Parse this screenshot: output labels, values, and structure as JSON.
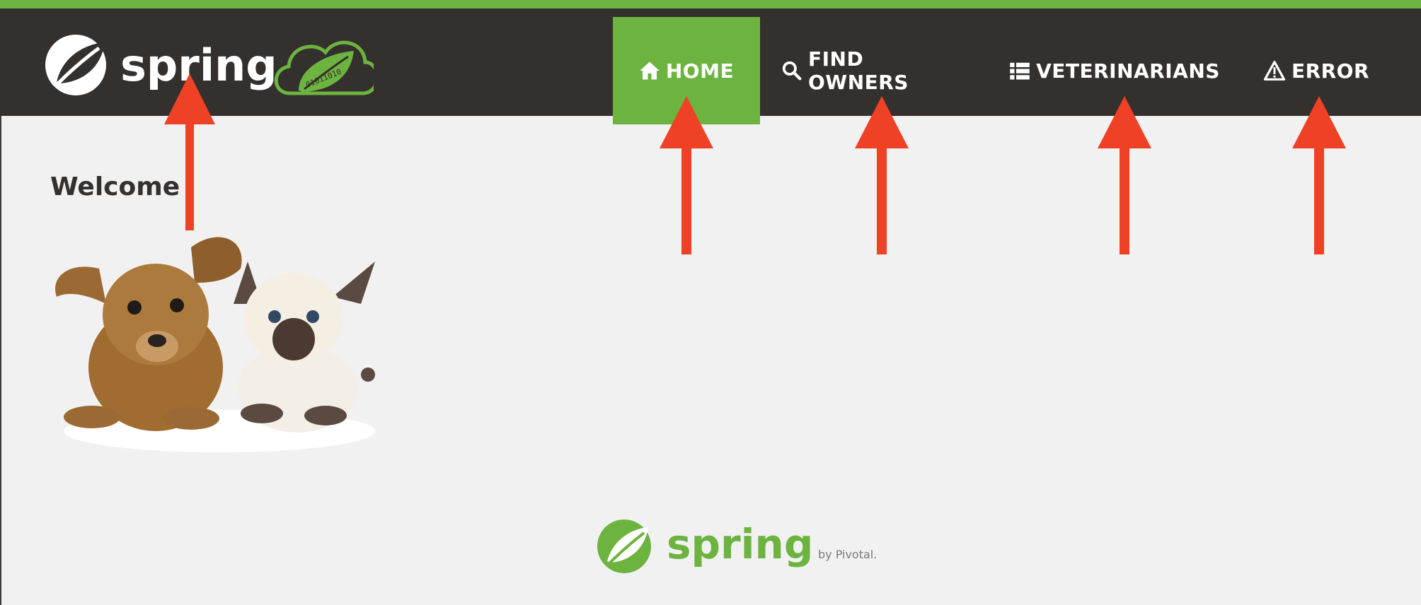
{
  "header": {
    "logo": {
      "wordmark": "spring",
      "badge_text": "01011010"
    },
    "nav": [
      {
        "label": "HOME",
        "icon": "home-icon",
        "active": true
      },
      {
        "label": "FIND OWNERS",
        "icon": "search-icon",
        "active": false
      },
      {
        "label": "VETERINARIANS",
        "icon": "list-icon",
        "active": false
      },
      {
        "label": "ERROR",
        "icon": "warning-icon",
        "active": false
      }
    ]
  },
  "main": {
    "title": "Welcome",
    "image": "pets-dog-and-cat"
  },
  "footer": {
    "logo_wordmark": "spring",
    "byline": "by Pivotal."
  },
  "annotations": {
    "arrow_color": "#ee4126",
    "count": 5
  },
  "colors": {
    "brand_green": "#6db33f",
    "header_bg": "#34302d",
    "page_bg": "#f1f1f1",
    "text": "#34302d"
  }
}
